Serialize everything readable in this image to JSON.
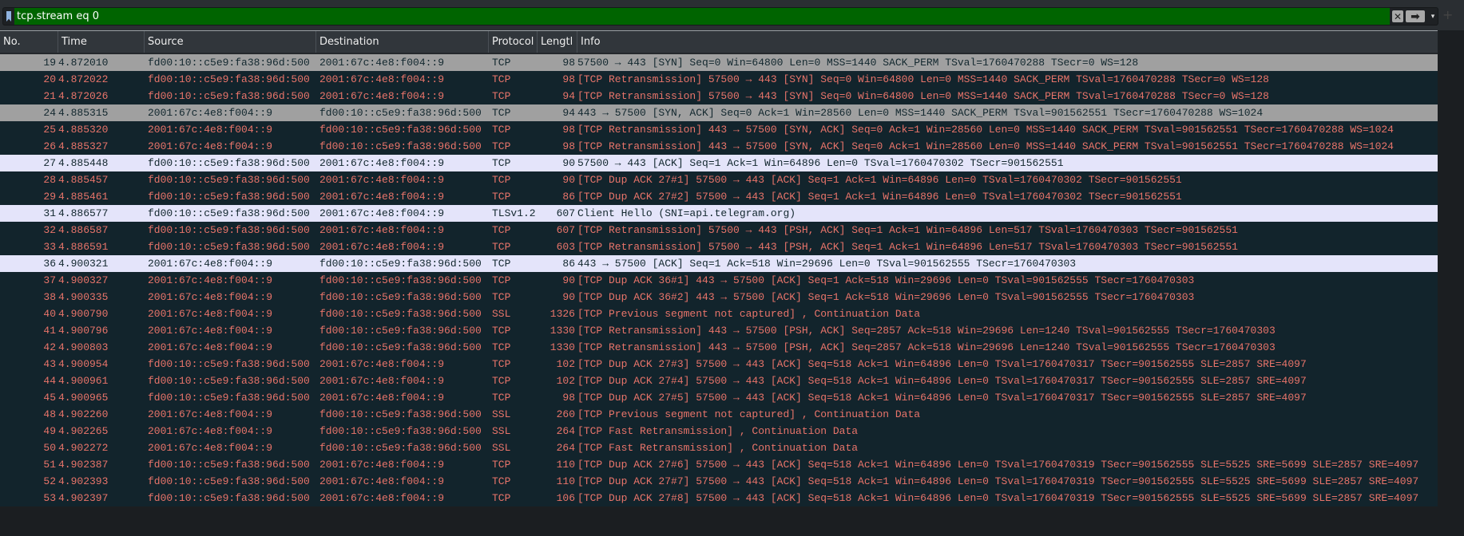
{
  "filter": {
    "value": "tcp.stream eq 0",
    "clear_icon": "✕",
    "apply_icon": "➡",
    "dropdown_icon": "▾",
    "add_icon": "+"
  },
  "columns": {
    "no": "No.",
    "time": "Time",
    "source": "Source",
    "destination": "Destination",
    "protocol": "Protocol",
    "length": "Lengtl",
    "info": "Info"
  },
  "colors": {
    "filter_bg": "#006400",
    "row_bg": "#12242c",
    "row_text_red": "#e8746a",
    "row_gray": "#a0a0a0",
    "row_lavender": "#e4e4fa"
  },
  "packets": [
    {
      "no": "19",
      "time": "4.872010",
      "src": "fd00:10::c5e9:fa38:96d:500",
      "dst": "2001:67c:4e8:f004::9",
      "proto": "TCP",
      "len": "98",
      "info": "57500 → 443 [SYN] Seq=0 Win=64800 Len=0 MSS=1440 SACK_PERM TSval=1760470288 TSecr=0 WS=128",
      "style": "gray"
    },
    {
      "no": "20",
      "time": "4.872022",
      "src": "fd00:10::c5e9:fa38:96d:500",
      "dst": "2001:67c:4e8:f004::9",
      "proto": "TCP",
      "len": "98",
      "info": "[TCP Retransmission] 57500 → 443 [SYN] Seq=0 Win=64800 Len=0 MSS=1440 SACK_PERM TSval=1760470288 TSecr=0 WS=128",
      "style": "dark"
    },
    {
      "no": "21",
      "time": "4.872026",
      "src": "fd00:10::c5e9:fa38:96d:500",
      "dst": "2001:67c:4e8:f004::9",
      "proto": "TCP",
      "len": "94",
      "info": "[TCP Retransmission] 57500 → 443 [SYN] Seq=0 Win=64800 Len=0 MSS=1440 SACK_PERM TSval=1760470288 TSecr=0 WS=128",
      "style": "dark"
    },
    {
      "no": "24",
      "time": "4.885315",
      "src": "2001:67c:4e8:f004::9",
      "dst": "fd00:10::c5e9:fa38:96d:500",
      "proto": "TCP",
      "len": "94",
      "info": "443 → 57500 [SYN, ACK] Seq=0 Ack=1 Win=28560 Len=0 MSS=1440 SACK_PERM TSval=901562551 TSecr=1760470288 WS=1024",
      "style": "gray"
    },
    {
      "no": "25",
      "time": "4.885320",
      "src": "2001:67c:4e8:f004::9",
      "dst": "fd00:10::c5e9:fa38:96d:500",
      "proto": "TCP",
      "len": "98",
      "info": "[TCP Retransmission] 443 → 57500 [SYN, ACK] Seq=0 Ack=1 Win=28560 Len=0 MSS=1440 SACK_PERM TSval=901562551 TSecr=1760470288 WS=1024",
      "style": "dark"
    },
    {
      "no": "26",
      "time": "4.885327",
      "src": "2001:67c:4e8:f004::9",
      "dst": "fd00:10::c5e9:fa38:96d:500",
      "proto": "TCP",
      "len": "98",
      "info": "[TCP Retransmission] 443 → 57500 [SYN, ACK] Seq=0 Ack=1 Win=28560 Len=0 MSS=1440 SACK_PERM TSval=901562551 TSecr=1760470288 WS=1024",
      "style": "dark"
    },
    {
      "no": "27",
      "time": "4.885448",
      "src": "fd00:10::c5e9:fa38:96d:500",
      "dst": "2001:67c:4e8:f004::9",
      "proto": "TCP",
      "len": "90",
      "info": "57500 → 443 [ACK] Seq=1 Ack=1 Win=64896 Len=0 TSval=1760470302 TSecr=901562551",
      "style": "lav"
    },
    {
      "no": "28",
      "time": "4.885457",
      "src": "fd00:10::c5e9:fa38:96d:500",
      "dst": "2001:67c:4e8:f004::9",
      "proto": "TCP",
      "len": "90",
      "info": "[TCP Dup ACK 27#1] 57500 → 443 [ACK] Seq=1 Ack=1 Win=64896 Len=0 TSval=1760470302 TSecr=901562551",
      "style": "dark"
    },
    {
      "no": "29",
      "time": "4.885461",
      "src": "fd00:10::c5e9:fa38:96d:500",
      "dst": "2001:67c:4e8:f004::9",
      "proto": "TCP",
      "len": "86",
      "info": "[TCP Dup ACK 27#2] 57500 → 443 [ACK] Seq=1 Ack=1 Win=64896 Len=0 TSval=1760470302 TSecr=901562551",
      "style": "dark"
    },
    {
      "no": "31",
      "time": "4.886577",
      "src": "fd00:10::c5e9:fa38:96d:500",
      "dst": "2001:67c:4e8:f004::9",
      "proto": "TLSv1.2",
      "len": "607",
      "info": "Client Hello (SNI=api.telegram.org)",
      "style": "lav"
    },
    {
      "no": "32",
      "time": "4.886587",
      "src": "fd00:10::c5e9:fa38:96d:500",
      "dst": "2001:67c:4e8:f004::9",
      "proto": "TCP",
      "len": "607",
      "info": "[TCP Retransmission] 57500 → 443 [PSH, ACK] Seq=1 Ack=1 Win=64896 Len=517 TSval=1760470303 TSecr=901562551",
      "style": "dark"
    },
    {
      "no": "33",
      "time": "4.886591",
      "src": "fd00:10::c5e9:fa38:96d:500",
      "dst": "2001:67c:4e8:f004::9",
      "proto": "TCP",
      "len": "603",
      "info": "[TCP Retransmission] 57500 → 443 [PSH, ACK] Seq=1 Ack=1 Win=64896 Len=517 TSval=1760470303 TSecr=901562551",
      "style": "dark"
    },
    {
      "no": "36",
      "time": "4.900321",
      "src": "2001:67c:4e8:f004::9",
      "dst": "fd00:10::c5e9:fa38:96d:500",
      "proto": "TCP",
      "len": "86",
      "info": "443 → 57500 [ACK] Seq=1 Ack=518 Win=29696 Len=0 TSval=901562555 TSecr=1760470303",
      "style": "lav"
    },
    {
      "no": "37",
      "time": "4.900327",
      "src": "2001:67c:4e8:f004::9",
      "dst": "fd00:10::c5e9:fa38:96d:500",
      "proto": "TCP",
      "len": "90",
      "info": "[TCP Dup ACK 36#1] 443 → 57500 [ACK] Seq=1 Ack=518 Win=29696 Len=0 TSval=901562555 TSecr=1760470303",
      "style": "dark"
    },
    {
      "no": "38",
      "time": "4.900335",
      "src": "2001:67c:4e8:f004::9",
      "dst": "fd00:10::c5e9:fa38:96d:500",
      "proto": "TCP",
      "len": "90",
      "info": "[TCP Dup ACK 36#2] 443 → 57500 [ACK] Seq=1 Ack=518 Win=29696 Len=0 TSval=901562555 TSecr=1760470303",
      "style": "dark"
    },
    {
      "no": "40",
      "time": "4.900790",
      "src": "2001:67c:4e8:f004::9",
      "dst": "fd00:10::c5e9:fa38:96d:500",
      "proto": "SSL",
      "len": "1326",
      "info": "[TCP Previous segment not captured] , Continuation Data",
      "style": "dark"
    },
    {
      "no": "41",
      "time": "4.900796",
      "src": "2001:67c:4e8:f004::9",
      "dst": "fd00:10::c5e9:fa38:96d:500",
      "proto": "TCP",
      "len": "1330",
      "info": "[TCP Retransmission] 443 → 57500 [PSH, ACK] Seq=2857 Ack=518 Win=29696 Len=1240 TSval=901562555 TSecr=1760470303",
      "style": "dark"
    },
    {
      "no": "42",
      "time": "4.900803",
      "src": "2001:67c:4e8:f004::9",
      "dst": "fd00:10::c5e9:fa38:96d:500",
      "proto": "TCP",
      "len": "1330",
      "info": "[TCP Retransmission] 443 → 57500 [PSH, ACK] Seq=2857 Ack=518 Win=29696 Len=1240 TSval=901562555 TSecr=1760470303",
      "style": "dark"
    },
    {
      "no": "43",
      "time": "4.900954",
      "src": "fd00:10::c5e9:fa38:96d:500",
      "dst": "2001:67c:4e8:f004::9",
      "proto": "TCP",
      "len": "102",
      "info": "[TCP Dup ACK 27#3] 57500 → 443 [ACK] Seq=518 Ack=1 Win=64896 Len=0 TSval=1760470317 TSecr=901562555 SLE=2857 SRE=4097",
      "style": "dark"
    },
    {
      "no": "44",
      "time": "4.900961",
      "src": "fd00:10::c5e9:fa38:96d:500",
      "dst": "2001:67c:4e8:f004::9",
      "proto": "TCP",
      "len": "102",
      "info": "[TCP Dup ACK 27#4] 57500 → 443 [ACK] Seq=518 Ack=1 Win=64896 Len=0 TSval=1760470317 TSecr=901562555 SLE=2857 SRE=4097",
      "style": "dark"
    },
    {
      "no": "45",
      "time": "4.900965",
      "src": "fd00:10::c5e9:fa38:96d:500",
      "dst": "2001:67c:4e8:f004::9",
      "proto": "TCP",
      "len": "98",
      "info": "[TCP Dup ACK 27#5] 57500 → 443 [ACK] Seq=518 Ack=1 Win=64896 Len=0 TSval=1760470317 TSecr=901562555 SLE=2857 SRE=4097",
      "style": "dark"
    },
    {
      "no": "48",
      "time": "4.902260",
      "src": "2001:67c:4e8:f004::9",
      "dst": "fd00:10::c5e9:fa38:96d:500",
      "proto": "SSL",
      "len": "260",
      "info": "[TCP Previous segment not captured] , Continuation Data",
      "style": "dark"
    },
    {
      "no": "49",
      "time": "4.902265",
      "src": "2001:67c:4e8:f004::9",
      "dst": "fd00:10::c5e9:fa38:96d:500",
      "proto": "SSL",
      "len": "264",
      "info": "[TCP Fast Retransmission] , Continuation Data",
      "style": "dark"
    },
    {
      "no": "50",
      "time": "4.902272",
      "src": "2001:67c:4e8:f004::9",
      "dst": "fd00:10::c5e9:fa38:96d:500",
      "proto": "SSL",
      "len": "264",
      "info": "[TCP Fast Retransmission] , Continuation Data",
      "style": "dark"
    },
    {
      "no": "51",
      "time": "4.902387",
      "src": "fd00:10::c5e9:fa38:96d:500",
      "dst": "2001:67c:4e8:f004::9",
      "proto": "TCP",
      "len": "110",
      "info": "[TCP Dup ACK 27#6] 57500 → 443 [ACK] Seq=518 Ack=1 Win=64896 Len=0 TSval=1760470319 TSecr=901562555 SLE=5525 SRE=5699 SLE=2857 SRE=4097",
      "style": "dark"
    },
    {
      "no": "52",
      "time": "4.902393",
      "src": "fd00:10::c5e9:fa38:96d:500",
      "dst": "2001:67c:4e8:f004::9",
      "proto": "TCP",
      "len": "110",
      "info": "[TCP Dup ACK 27#7] 57500 → 443 [ACK] Seq=518 Ack=1 Win=64896 Len=0 TSval=1760470319 TSecr=901562555 SLE=5525 SRE=5699 SLE=2857 SRE=4097",
      "style": "dark"
    },
    {
      "no": "53",
      "time": "4.902397",
      "src": "fd00:10::c5e9:fa38:96d:500",
      "dst": "2001:67c:4e8:f004::9",
      "proto": "TCP",
      "len": "106",
      "info": "[TCP Dup ACK 27#8] 57500 → 443 [ACK] Seq=518 Ack=1 Win=64896 Len=0 TSval=1760470319 TSecr=901562555 SLE=5525 SRE=5699 SLE=2857 SRE=4097",
      "style": "dark"
    }
  ]
}
